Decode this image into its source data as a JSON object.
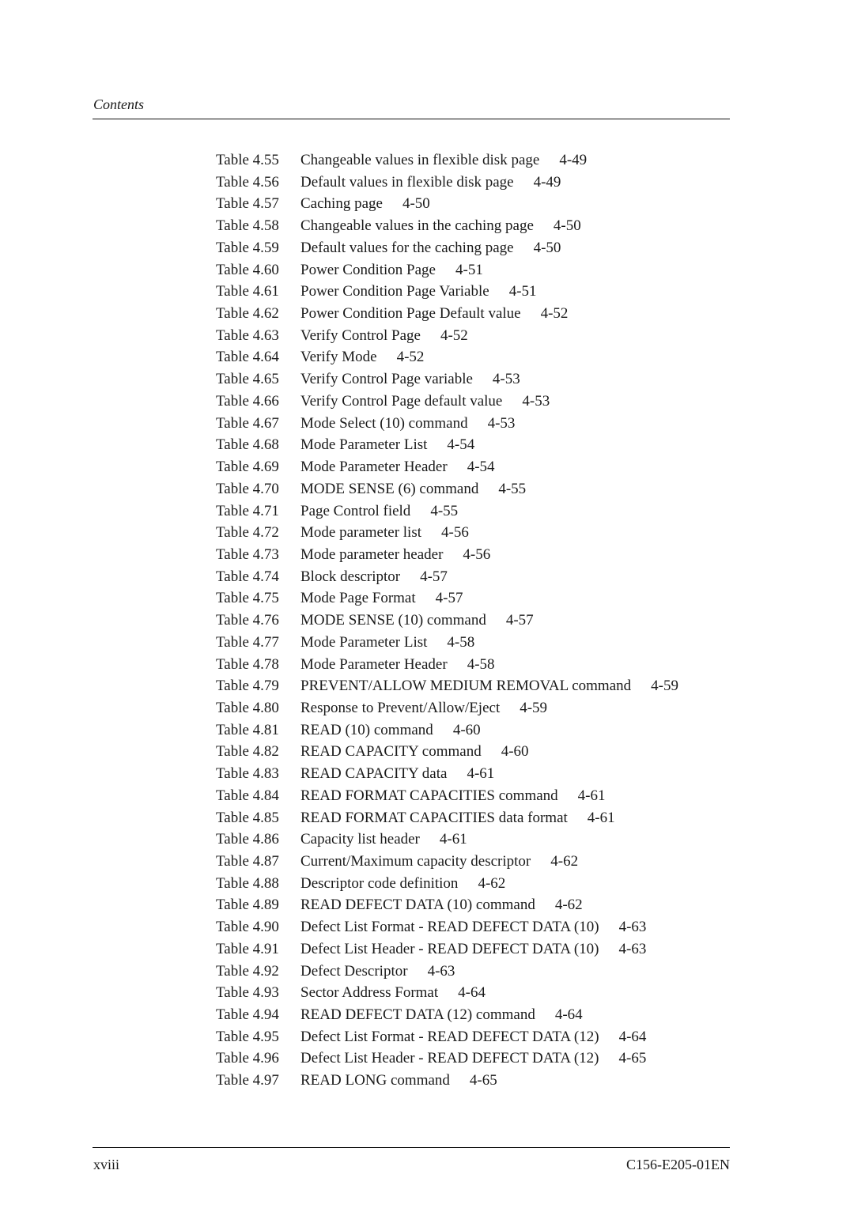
{
  "header": {
    "title": "Contents"
  },
  "entries": [
    {
      "label": "Table 4.55",
      "title": "Changeable values in flexible disk page",
      "page": "4-49"
    },
    {
      "label": "Table 4.56",
      "title": "Default values in flexible disk page",
      "page": "4-49"
    },
    {
      "label": "Table 4.57",
      "title": "Caching page",
      "page": "4-50"
    },
    {
      "label": "Table 4.58",
      "title": "Changeable values in the caching page",
      "page": "4-50"
    },
    {
      "label": "Table 4.59",
      "title": "Default values for the caching page",
      "page": "4-50"
    },
    {
      "label": "Table 4.60",
      "title": "Power Condition Page",
      "page": "4-51"
    },
    {
      "label": "Table 4.61",
      "title": "Power Condition Page Variable",
      "page": "4-51"
    },
    {
      "label": "Table 4.62",
      "title": "Power Condition Page Default value",
      "page": "4-52"
    },
    {
      "label": "Table 4.63",
      "title": "Verify Control Page",
      "page": "4-52"
    },
    {
      "label": "Table 4.64",
      "title": "Verify Mode",
      "page": "4-52"
    },
    {
      "label": "Table 4.65",
      "title": "Verify Control Page variable",
      "page": "4-53"
    },
    {
      "label": "Table 4.66",
      "title": "Verify Control Page default value",
      "page": "4-53"
    },
    {
      "label": "Table 4.67",
      "title": "Mode Select (10) command",
      "page": "4-53"
    },
    {
      "label": "Table 4.68",
      "title": "Mode Parameter List",
      "page": "4-54"
    },
    {
      "label": "Table 4.69",
      "title": "Mode Parameter Header",
      "page": "4-54"
    },
    {
      "label": "Table 4.70",
      "title": "MODE SENSE (6) command",
      "page": "4-55"
    },
    {
      "label": "Table 4.71",
      "title": "Page Control field",
      "page": "4-55"
    },
    {
      "label": "Table 4.72",
      "title": "Mode parameter list",
      "page": "4-56"
    },
    {
      "label": "Table 4.73",
      "title": "Mode parameter header",
      "page": "4-56"
    },
    {
      "label": "Table 4.74",
      "title": "Block descriptor",
      "page": "4-57"
    },
    {
      "label": "Table 4.75",
      "title": "Mode Page Format",
      "page": "4-57"
    },
    {
      "label": "Table 4.76",
      "title": "MODE SENSE (10) command",
      "page": "4-57"
    },
    {
      "label": "Table 4.77",
      "title": "Mode Parameter List",
      "page": "4-58"
    },
    {
      "label": "Table 4.78",
      "title": "Mode Parameter Header",
      "page": "4-58"
    },
    {
      "label": "Table 4.79",
      "title": "PREVENT/ALLOW MEDIUM REMOVAL command",
      "page": "4-59"
    },
    {
      "label": "Table 4.80",
      "title": "Response to Prevent/Allow/Eject",
      "page": "4-59"
    },
    {
      "label": "Table 4.81",
      "title": "READ (10) command",
      "page": "4-60"
    },
    {
      "label": "Table 4.82",
      "title": "READ CAPACITY command",
      "page": "4-60"
    },
    {
      "label": "Table 4.83",
      "title": "READ CAPACITY data",
      "page": "4-61"
    },
    {
      "label": "Table 4.84",
      "title": "READ FORMAT CAPACITIES command",
      "page": "4-61"
    },
    {
      "label": "Table 4.85",
      "title": "READ FORMAT CAPACITIES data format",
      "page": "4-61"
    },
    {
      "label": "Table 4.86",
      "title": "Capacity list header",
      "page": "4-61"
    },
    {
      "label": "Table 4.87",
      "title": "Current/Maximum capacity descriptor",
      "page": "4-62"
    },
    {
      "label": "Table 4.88",
      "title": "Descriptor code definition",
      "page": "4-62"
    },
    {
      "label": "Table 4.89",
      "title": "READ DEFECT DATA (10) command",
      "page": "4-62"
    },
    {
      "label": "Table 4.90",
      "title": "Defect List Format - READ DEFECT DATA (10)",
      "page": "4-63"
    },
    {
      "label": "Table 4.91",
      "title": "Defect List Header - READ DEFECT DATA (10)",
      "page": "4-63"
    },
    {
      "label": "Table 4.92",
      "title": "Defect Descriptor",
      "page": "4-63"
    },
    {
      "label": "Table 4.93",
      "title": "Sector Address Format",
      "page": "4-64"
    },
    {
      "label": "Table 4.94",
      "title": "READ DEFECT DATA (12) command",
      "page": "4-64"
    },
    {
      "label": "Table 4.95",
      "title": "Defect List Format - READ DEFECT DATA (12)",
      "page": "4-64"
    },
    {
      "label": "Table 4.96",
      "title": "Defect List Header - READ DEFECT DATA (12)",
      "page": "4-65"
    },
    {
      "label": "Table 4.97",
      "title": "READ LONG command",
      "page": "4-65"
    }
  ],
  "footer": {
    "page_number": "xviii",
    "doc_code": "C156-E205-01EN"
  }
}
